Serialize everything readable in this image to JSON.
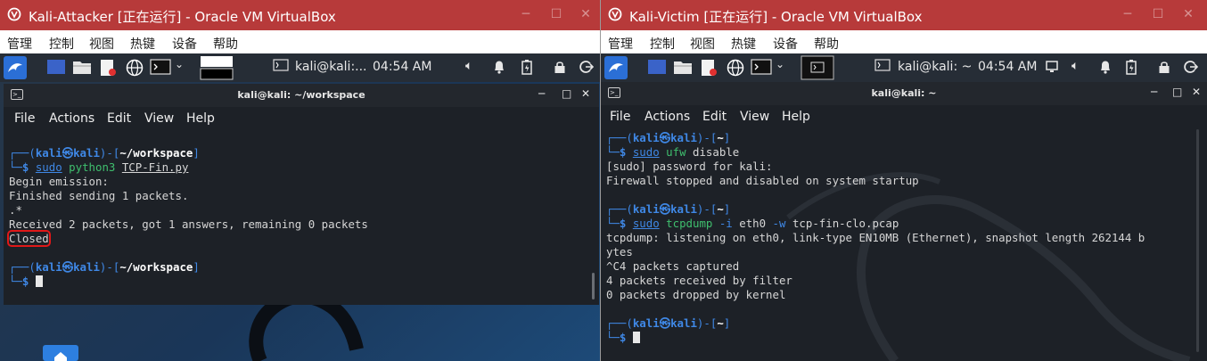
{
  "left_vm": {
    "title": "Kali-Attacker [正在运行] - Oracle VM VirtualBox",
    "vbox_menu": [
      "管理",
      "控制",
      "视图",
      "热键",
      "设备",
      "帮助"
    ],
    "panel": {
      "task_label": "kali@kali:...",
      "clock": "04:54 AM"
    },
    "terminal": {
      "title": "kali@kali: ~/workspace",
      "menu": [
        "File",
        "Actions",
        "Edit",
        "View",
        "Help"
      ],
      "prompt1": {
        "user": "kali",
        "sep": "㉿",
        "host": "kali",
        "path": "~/workspace"
      },
      "cmd1": {
        "sudo": "sudo",
        "prog": "python3",
        "arg": "TCP-Fin.py"
      },
      "output": [
        "Begin emission:",
        "Finished sending 1 packets.",
        ".*",
        "Received 2 packets, got 1 answers, remaining 0 packets"
      ],
      "result": "Closed",
      "prompt2": {
        "user": "kali",
        "sep": "㉿",
        "host": "kali",
        "path": "~/workspace"
      }
    }
  },
  "right_vm": {
    "title": "Kali-Victim [正在运行] - Oracle VM VirtualBox",
    "vbox_menu": [
      "管理",
      "控制",
      "视图",
      "热键",
      "设备",
      "帮助"
    ],
    "panel": {
      "task_label": "kali@kali: ~",
      "clock": "04:54 AM"
    },
    "terminal": {
      "title": "kali@kali: ~",
      "menu": [
        "File",
        "Actions",
        "Edit",
        "View",
        "Help"
      ],
      "prompt1": {
        "user": "kali",
        "sep": "㉿",
        "host": "kali",
        "path": "~"
      },
      "cmd1": {
        "sudo": "sudo",
        "prog": "ufw",
        "rest": "disable"
      },
      "output1": [
        "[sudo] password for kali:",
        "Firewall stopped and disabled on system startup"
      ],
      "prompt2": {
        "user": "kali",
        "sep": "㉿",
        "host": "kali",
        "path": "~"
      },
      "cmd2": {
        "sudo": "sudo",
        "prog": "tcpdump",
        "flag1": "-i",
        "iface": "eth0",
        "flag2": "-w",
        "file": "tcp-fin-clo.pcap"
      },
      "output2": [
        "tcpdump: listening on eth0, link-type EN10MB (Ethernet), snapshot length 262144 b",
        "ytes",
        "^C4 packets captured",
        "4 packets received by filter",
        "0 packets dropped by kernel"
      ],
      "prompt3": {
        "user": "kali",
        "sep": "㉿",
        "host": "kali",
        "path": "~"
      }
    }
  },
  "colors": {
    "vbox_titlebar": "#b73a3a",
    "prompt_blue": "#3f88e6",
    "command_green": "#3fbf6e",
    "highlight_red": "#e01818"
  }
}
